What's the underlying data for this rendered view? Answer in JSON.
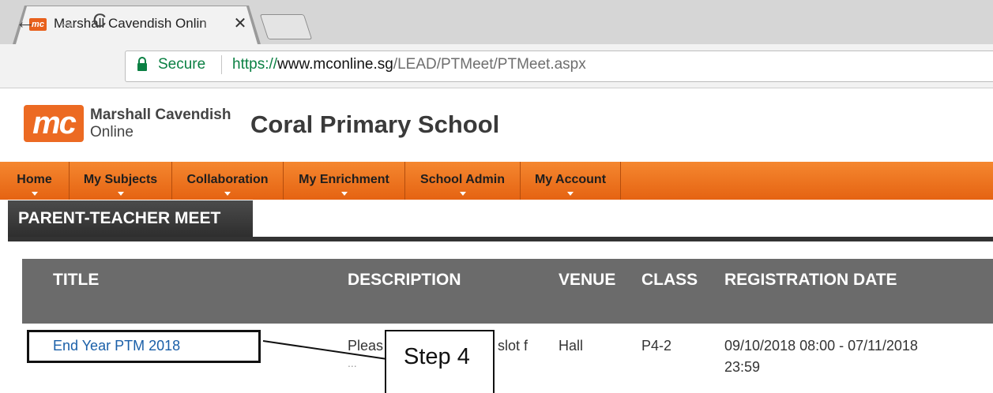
{
  "browser": {
    "tab_title": "Marshall Cavendish Onlin",
    "tab_close": "✕",
    "favicon_text": "mc",
    "nav": {
      "back": "←",
      "forward": "→",
      "reload": "C"
    },
    "secure_label": "Secure",
    "url": {
      "protocol": "https://",
      "host": "www.mconline.sg",
      "path": "/LEAD/PTMeet/PTMeet.aspx"
    }
  },
  "site": {
    "logo_text": "mc",
    "logo_name_line1": "Marshall Cavendish",
    "logo_name_line2": "Online",
    "school_name": "Coral Primary School",
    "brand_color": "#ec6a22"
  },
  "menu": {
    "items": [
      {
        "label": "Home"
      },
      {
        "label": "My Subjects"
      },
      {
        "label": "Collaboration"
      },
      {
        "label": "My Enrichment"
      },
      {
        "label": "School Admin"
      },
      {
        "label": "My Account"
      }
    ]
  },
  "page": {
    "section_title": "PARENT-TEACHER MEET"
  },
  "table": {
    "headers": [
      "TITLE",
      "DESCRIPTION",
      "VENUE",
      "CLASS",
      "REGISTRATION DATE"
    ],
    "rows": [
      {
        "title": "End Year PTM 2018",
        "description_visible": "Pleas",
        "description_tail": "slot f",
        "description_more": "...",
        "venue": "Hall",
        "class": "P4-2",
        "registration_line1": "09/10/2018 08:00 - 07/11/2018",
        "registration_line2": "23:59"
      }
    ]
  },
  "annotation": {
    "callout_text": "Step 4"
  }
}
